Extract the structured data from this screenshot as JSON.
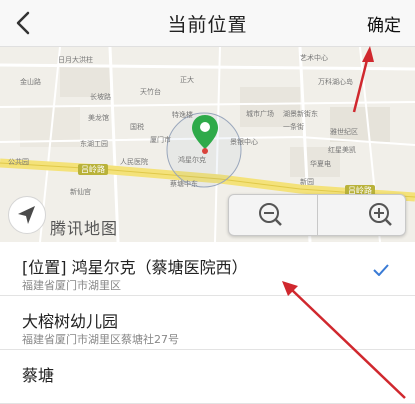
{
  "header": {
    "back_icon": "chevron-left-icon",
    "title": "当前位置",
    "confirm_label": "确定"
  },
  "map": {
    "brand": "腾讯地图",
    "road_label": "吕岭路",
    "road_label_right": "吕岭路",
    "labels": [
      "日月大洪柱",
      "艺术中心",
      "天竹台",
      "万科湖心岛",
      "城市广场",
      "特逸楼",
      "正大",
      "国税",
      "湖景新街东",
      "一条街",
      "厦门市",
      "长坡路",
      "雅世纪区",
      "红星美凯",
      "美龙馆",
      "景银中心",
      "华夏电",
      "东湖工园",
      "金山路",
      "蔡塘中东",
      "公共园",
      "鸿星尔克",
      "人民医院",
      "新仙宫",
      "新园"
    ],
    "zoom_out_icon": "zoom-out-icon",
    "zoom_in_icon": "zoom-in-icon",
    "compass_icon": "compass-arrow-icon",
    "pin_icon": "location-pin-icon"
  },
  "list": {
    "items": [
      {
        "title": "[位置] 鸿星尔克（蔡塘医院西）",
        "address": "福建省厦门市湖里区",
        "selected": true
      },
      {
        "title": "大榕树幼儿园",
        "address": "福建省厦门市湖里区蔡塘社27号"
      },
      {
        "title": "蔡塘",
        "address": ""
      }
    ]
  },
  "colors": {
    "annotation_arrow": "#d0282e",
    "pin": "#2eaa4a",
    "check": "#3a7bd5"
  }
}
